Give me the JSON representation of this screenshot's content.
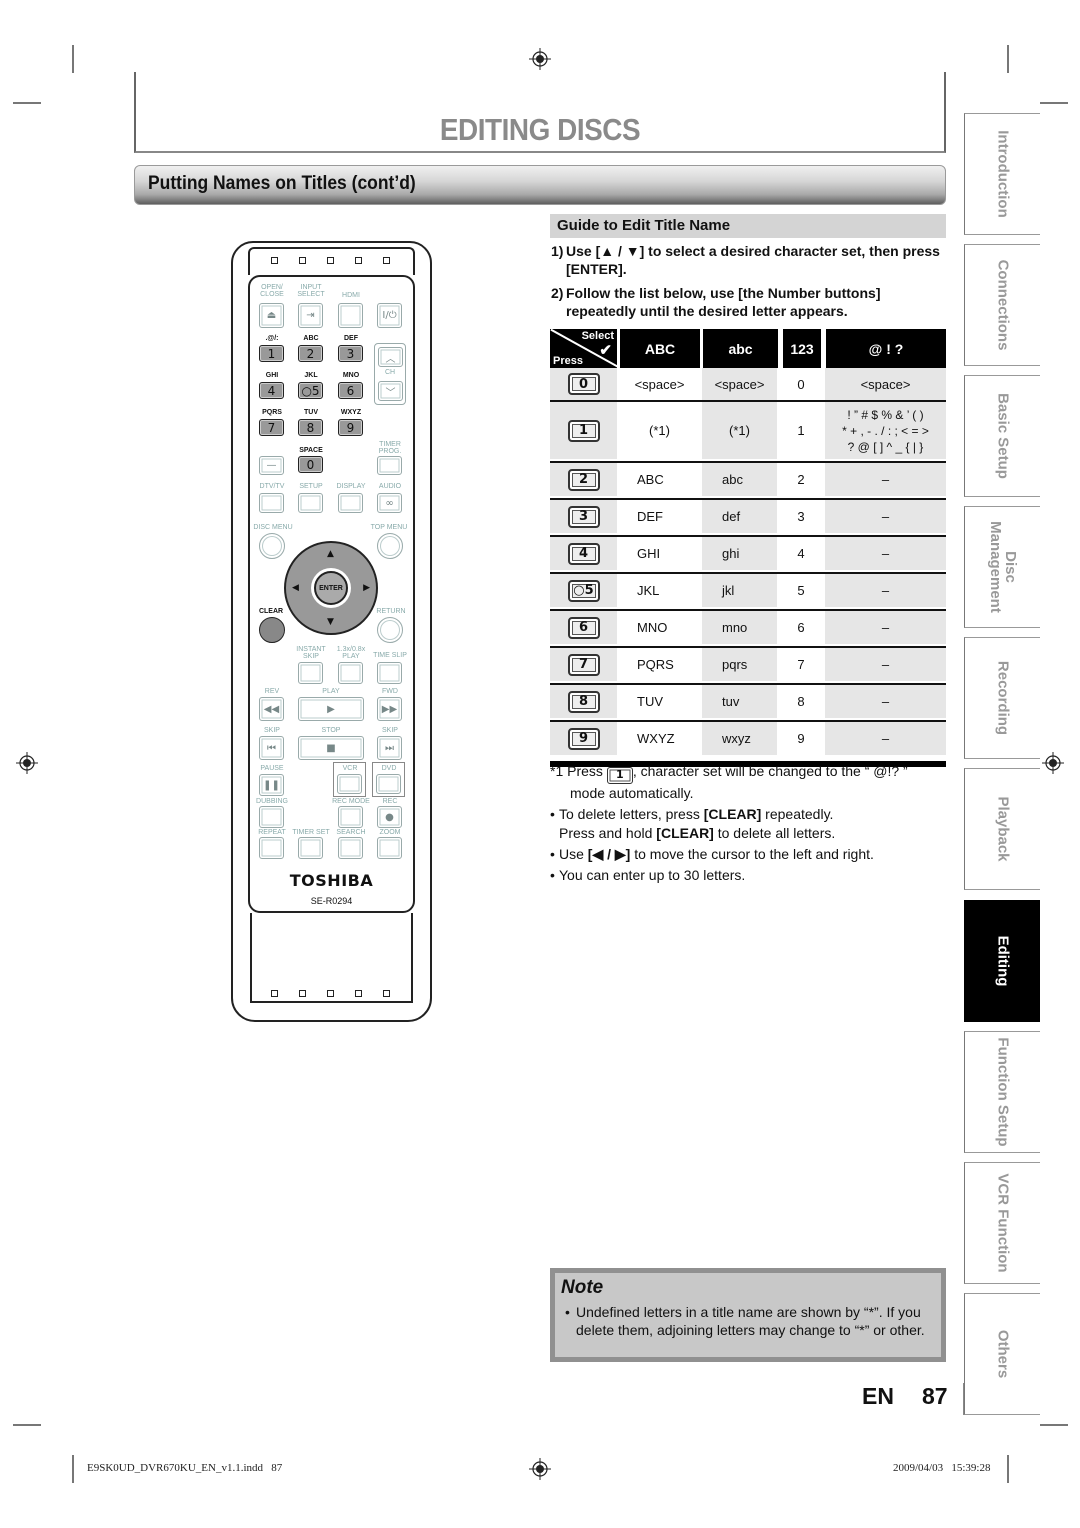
{
  "header": {
    "page_title": "EDITING DISCS",
    "section_title": "Putting Names on Titles (cont’d)"
  },
  "side_tabs": [
    {
      "label": "Introduction",
      "active": false
    },
    {
      "label": "Connections",
      "active": false
    },
    {
      "label": "Basic Setup",
      "active": false
    },
    {
      "label": "Disc\nManagement",
      "active": false
    },
    {
      "label": "Recording",
      "active": false
    },
    {
      "label": "Playback",
      "active": false
    },
    {
      "label": "Editing",
      "active": true
    },
    {
      "label": "Function Setup",
      "active": false
    },
    {
      "label": "VCR Function",
      "active": false
    },
    {
      "label": "Others",
      "active": false
    }
  ],
  "guide": {
    "heading": "Guide to Edit Title Name",
    "steps": [
      {
        "num": "1)",
        "text": "Use [▲ / ▼] to select a desired character set, then press [ENTER]."
      },
      {
        "num": "2)",
        "text": "Follow the list below, use [the Number buttons] repeatedly until the desired letter appears."
      }
    ]
  },
  "table": {
    "corner_select": "Select",
    "corner_press": "Press",
    "corner_check": "✔",
    "columns": [
      "ABC",
      "abc",
      "123",
      "@ ! ?"
    ],
    "rows": [
      {
        "key": "0",
        "abc_upper": "<space>",
        "abc_lower": "<space>",
        "num": "0",
        "sym": "<space>"
      },
      {
        "key": "1",
        "abc_upper": "(*1)",
        "abc_lower": "(*1)",
        "num": "1",
        "sym": "! ” # $ % & ’ ( )\n* + , - . / : ; < = >\n? @ [ ] ^ _ { | }"
      },
      {
        "key": "2",
        "abc_upper": "ABC",
        "abc_lower": "abc",
        "num": "2",
        "sym": "–"
      },
      {
        "key": "3",
        "abc_upper": "DEF",
        "abc_lower": "def",
        "num": "3",
        "sym": "–"
      },
      {
        "key": "4",
        "abc_upper": "GHI",
        "abc_lower": "ghi",
        "num": "4",
        "sym": "–"
      },
      {
        "key": "○5",
        "abc_upper": "JKL",
        "abc_lower": "jkl",
        "num": "5",
        "sym": "–"
      },
      {
        "key": "6",
        "abc_upper": "MNO",
        "abc_lower": "mno",
        "num": "6",
        "sym": "–"
      },
      {
        "key": "7",
        "abc_upper": "PQRS",
        "abc_lower": "pqrs",
        "num": "7",
        "sym": "–"
      },
      {
        "key": "8",
        "abc_upper": "TUV",
        "abc_lower": "tuv",
        "num": "8",
        "sym": "–"
      },
      {
        "key": "9",
        "abc_upper": "WXYZ",
        "abc_lower": "wxyz",
        "num": "9",
        "sym": "–"
      }
    ]
  },
  "notes": {
    "footnote_prefix": "*1 Press",
    "footnote_key": "1",
    "footnote_suffix": ", character set will be changed to the “ @!? ” mode automatically.",
    "bullets": [
      {
        "pre": "To delete letters, press ",
        "bold": "[CLEAR]",
        "post": " repeatedly."
      },
      {
        "pre": "Press and hold ",
        "bold": "[CLEAR]",
        "post": " to delete all letters.",
        "continuation": true
      },
      {
        "pre": "Use ",
        "bold": "[◀ / ▶]",
        "post": " to move the cursor to the left and right."
      },
      {
        "pre": "You can enter up to 30 letters.",
        "bold": "",
        "post": ""
      }
    ]
  },
  "note_box": {
    "title": "Note",
    "text": "Undefined letters in a title name are shown by “*”. If you delete them, adjoining letters may change to “*” or other."
  },
  "page": {
    "lang": "EN",
    "number": "87"
  },
  "footer": {
    "file": "E9SK0UD_DVR670KU_EN_v1.1.indd   87",
    "date": "2009/04/03   15:39:28"
  },
  "remote": {
    "brand": "TOSHIBA",
    "model": "SE-R0294",
    "labels": {
      "open_close": "OPEN/\nCLOSE",
      "input_select": "INPUT\nSELECT",
      "hdmi": "HDMI",
      "power": "I/⏻",
      "k1": ".@/:",
      "k2": "ABC",
      "k3": "DEF",
      "k4": "GHI",
      "k5": "JKL",
      "k6": "MNO",
      "k7": "PQRS",
      "k8": "TUV",
      "k9": "WXYZ",
      "k0": "SPACE",
      "ch": "CH",
      "timer_prog": "TIMER\nPROG.",
      "dtv_tv": "DTV/TV",
      "setup": "SETUP",
      "display": "DISPLAY",
      "audio": "AUDIO",
      "disc_menu": "DISC MENU",
      "top_menu": "TOP MENU",
      "enter": "ENTER",
      "clear": "CLEAR",
      "return": "RETURN",
      "instant_skip": "INSTANT\nSKIP",
      "play_speed": "1.3x/0.8x\nPLAY",
      "time_slip": "TIME SLIP",
      "rev": "REV",
      "play": "PLAY",
      "fwd": "FWD",
      "skip_back": "SKIP",
      "stop": "STOP",
      "skip_fwd": "SKIP",
      "pause": "PAUSE",
      "vcr": "VCR",
      "dvd": "DVD",
      "dubbing": "DUBBING",
      "rec_mode": "REC MODE",
      "rec": "REC",
      "repeat": "REPEAT",
      "timer_set": "TIMER SET",
      "search": "SEARCH",
      "zoom": "ZOOM"
    },
    "digits": [
      "1",
      "2",
      "3",
      "4",
      "○5",
      "6",
      "7",
      "8",
      "9",
      "0"
    ]
  }
}
